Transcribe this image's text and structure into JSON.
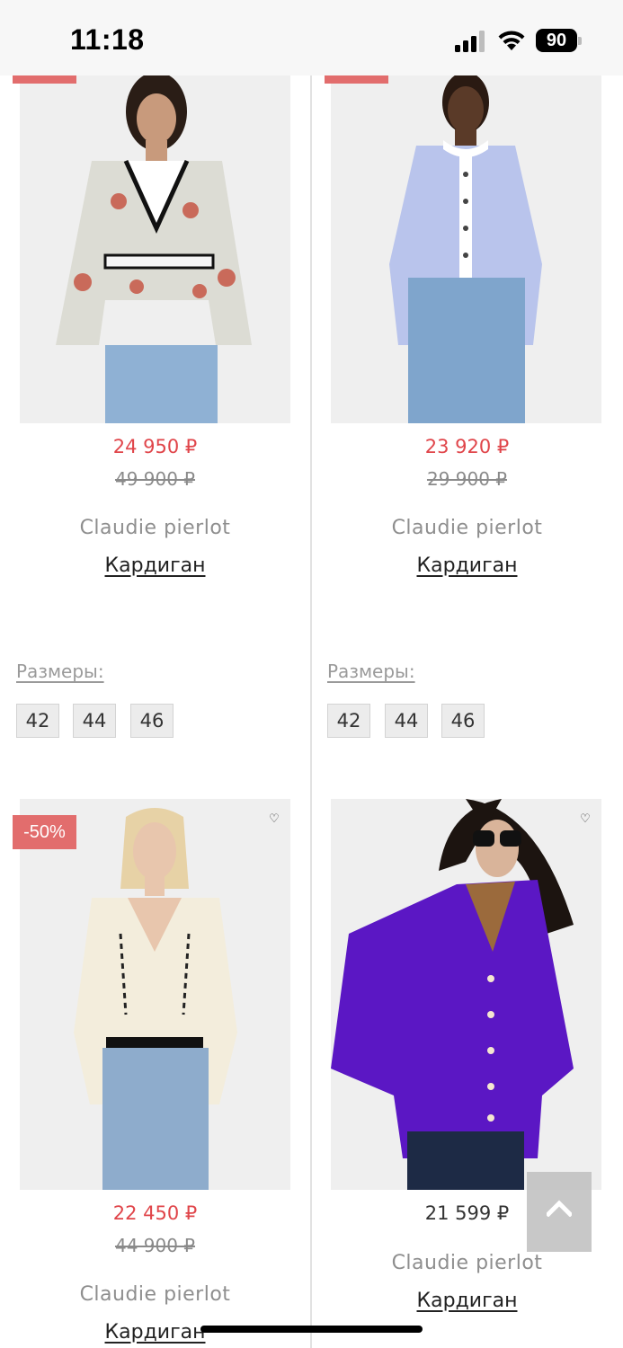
{
  "status_bar": {
    "time": "11:18",
    "battery_level": "90"
  },
  "colors": {
    "sale_price": "#e0454a",
    "badge": "#e26d6d",
    "divider": "#e2e2e2"
  },
  "products": [
    {
      "sale_price": "24 950 ₽",
      "old_price": "49 900 ₽",
      "brand": "Claudie pierlot",
      "name": "Кардиган",
      "sizes_label": "Размеры:",
      "sizes": [
        "42",
        "44",
        "46"
      ]
    },
    {
      "sale_price": "23 920 ₽",
      "old_price": "29 900 ₽",
      "brand": "Claudie pierlot",
      "name": "Кардиган",
      "sizes_label": "Размеры:",
      "sizes": [
        "42",
        "44",
        "46"
      ]
    },
    {
      "badge": "-50%",
      "wishlist_icon": "heart-outline-icon",
      "sale_price": "22 450 ₽",
      "old_price": "44 900 ₽",
      "brand": "Claudie pierlot",
      "name": "Кардиган"
    },
    {
      "wishlist_icon": "heart-outline-icon",
      "price": "21 599 ₽",
      "brand": "Claudie pierlot",
      "name": "Кардиган"
    }
  ],
  "back_to_top_icon": "chevron-up-icon"
}
